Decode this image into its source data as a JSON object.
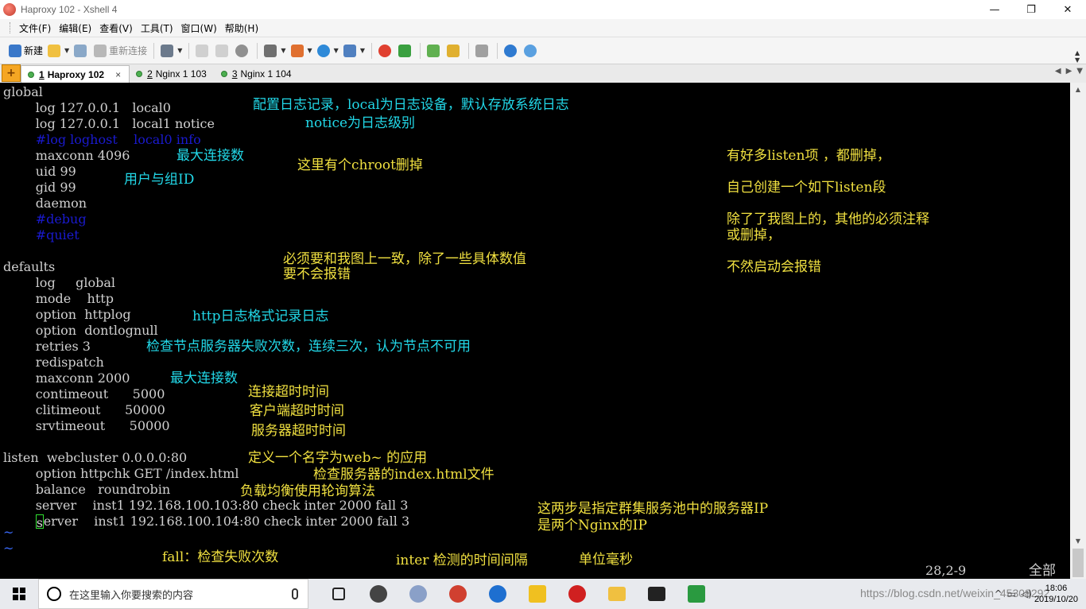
{
  "window": {
    "title": "Haproxy 102 - Xshell 4",
    "controls": {
      "minimize": "—",
      "maximize": "❐",
      "close": "✕"
    }
  },
  "menu": [
    "文件(F)",
    "编辑(E)",
    "查看(V)",
    "工具(T)",
    "窗口(W)",
    "帮助(H)"
  ],
  "toolbar": {
    "new_label": "新建",
    "reconnect_label": "重新连接"
  },
  "tabs": [
    {
      "num": "1",
      "label": "Haproxy 102",
      "active": true
    },
    {
      "num": "2",
      "label": "Nginx 1 103",
      "active": false
    },
    {
      "num": "3",
      "label": "Nginx 1 104",
      "active": false
    }
  ],
  "terminal": {
    "lines": [
      {
        "text": "global",
        "color": "#d0d0d0"
      },
      {
        "text": "        log 127.0.0.1   local0",
        "color": "#d0d0d0"
      },
      {
        "text": "        log 127.0.0.1   local1 notice",
        "color": "#d0d0d0"
      },
      {
        "text": "        #log loghost    local0 info",
        "color": "#1a1ad0"
      },
      {
        "text": "        maxconn 4096",
        "color": "#d0d0d0"
      },
      {
        "text": "        uid 99",
        "color": "#d0d0d0"
      },
      {
        "text": "        gid 99",
        "color": "#d0d0d0"
      },
      {
        "text": "        daemon",
        "color": "#d0d0d0"
      },
      {
        "text": "        #debug",
        "color": "#1a1ad0"
      },
      {
        "text": "        #quiet",
        "color": "#1a1ad0"
      },
      {
        "text": "",
        "color": "#d0d0d0"
      },
      {
        "text": "defaults",
        "color": "#d0d0d0"
      },
      {
        "text": "        log     global",
        "color": "#d0d0d0"
      },
      {
        "text": "        mode    http",
        "color": "#d0d0d0"
      },
      {
        "text": "        option  httplog",
        "color": "#d0d0d0"
      },
      {
        "text": "        option  dontlognull",
        "color": "#d0d0d0"
      },
      {
        "text": "        retries 3",
        "color": "#d0d0d0"
      },
      {
        "text": "        redispatch",
        "color": "#d0d0d0"
      },
      {
        "text": "        maxconn 2000",
        "color": "#d0d0d0"
      },
      {
        "text": "        contimeout      5000",
        "color": "#d0d0d0"
      },
      {
        "text": "        clitimeout      50000",
        "color": "#d0d0d0"
      },
      {
        "text": "        srvtimeout      50000",
        "color": "#d0d0d0"
      },
      {
        "text": "",
        "color": "#d0d0d0"
      },
      {
        "text": "listen  webcluster 0.0.0.0:80",
        "color": "#d0d0d0"
      },
      {
        "text": "        option httpchk GET /index.html",
        "color": "#d0d0d0"
      },
      {
        "text": "        balance   roundrobin",
        "color": "#d0d0d0"
      },
      {
        "text": "        server    inst1 192.168.100.103:80 check inter 2000 fall 3",
        "color": "#d0d0d0"
      }
    ],
    "last_line_rest": "erver    inst1 192.168.100.104:80 check inter 2000 fall 3",
    "last_line_cursor_char": "s",
    "tilde": "~",
    "status_pos": "28,2-9",
    "status_all": "全部"
  },
  "annotations": {
    "a1": "配置日志记录，local为日志设备，默认存放系统日志",
    "a2": "notice为日志级别",
    "a3": "最大连接数",
    "a4": "这里有个chroot删掉",
    "a5": "用户与组ID",
    "a6": "有好多listen项 ，都删掉，",
    "a7": "自己创建一个如下listen段",
    "a8": "除了了我图上的，其他的必须注释",
    "a9": "或删掉，",
    "a10": "不然启动会报错",
    "a11": "必须要和我图上一致，除了一些具体数值",
    "a12": "要不会报错",
    "a13": "http日志格式记录日志",
    "a14": "检查节点服务器失败次数，连续三次，认为节点不可用",
    "a15": "最大连接数",
    "a16": "连接超时时间",
    "a17": "客户端超时时间",
    "a18": "服务器超时时间",
    "a19": "定义一个名字为web~ 的应用",
    "a20": "检查服务器的index.html文件",
    "a21": "负载均衡使用轮询算法",
    "a22": "这两步是指定群集服务池中的服务器IP",
    "a23": "是两个Nginx的IP",
    "a24": "fall：检查失败次数",
    "a25": "inter 检测的时间间隔",
    "a26": "单位毫秒"
  },
  "taskbar": {
    "search_placeholder": "在这里输入你要搜索的内容",
    "time": "18:06",
    "date": "2019/10/20",
    "watermark": "https://blog.csdn.net/weixin_45308292"
  },
  "colors": {
    "annotation_cyan": "#22d8e8",
    "annotation_yellow": "#f0e040",
    "comment_blue": "#1a1ad0",
    "tab_status_green": "#4caf50"
  }
}
